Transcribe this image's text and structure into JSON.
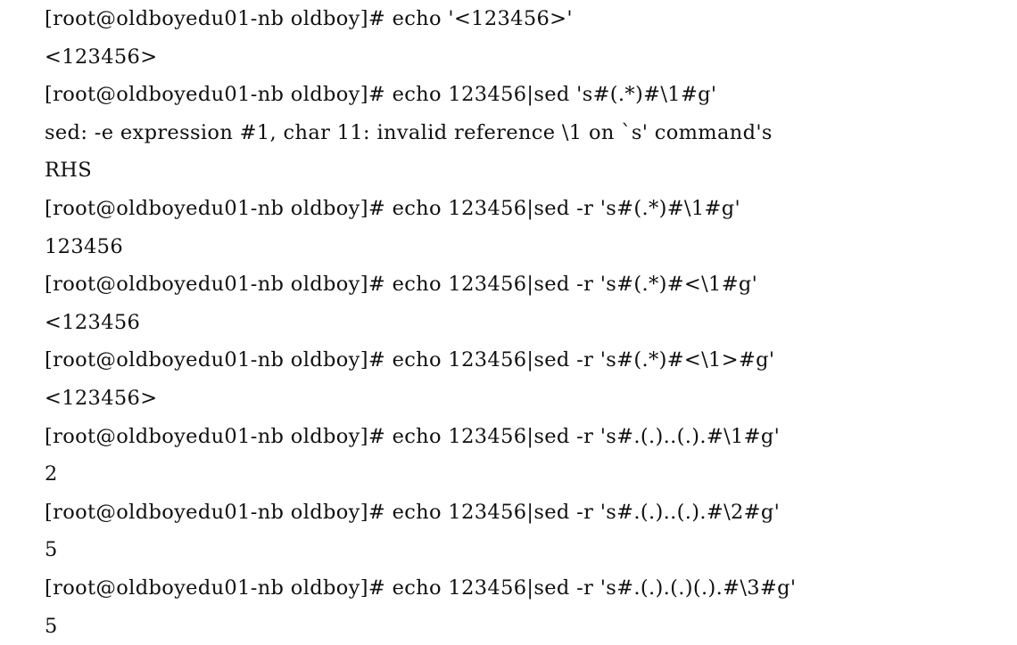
{
  "terminal": {
    "prompt": "[root@oldboyedu01-nb oldboy]#",
    "background_color": "#ffffff",
    "text_color": "#101010",
    "lines": [
      {
        "type": "command",
        "prompt": "[root@oldboyedu01-nb oldboy]#",
        "text": " echo '<123456>'"
      },
      {
        "type": "output",
        "text": "<123456>"
      },
      {
        "type": "command",
        "prompt": "[root@oldboyedu01-nb oldboy]#",
        "text": " echo 123456|sed 's#(.*)#\\1#g'"
      },
      {
        "type": "error",
        "text": "sed: -e expression #1, char 11: invalid reference \\1 on `s' command's"
      },
      {
        "type": "error",
        "text": "RHS"
      },
      {
        "type": "command",
        "prompt": "[root@oldboyedu01-nb oldboy]#",
        "text": " echo 123456|sed -r 's#(.*)#\\1#g'"
      },
      {
        "type": "output",
        "text": "123456"
      },
      {
        "type": "command",
        "prompt": "[root@oldboyedu01-nb oldboy]#",
        "text": " echo 123456|sed -r 's#(.*)#<\\1#g'"
      },
      {
        "type": "output",
        "text": "<123456"
      },
      {
        "type": "command",
        "prompt": "[root@oldboyedu01-nb oldboy]#",
        "text": " echo 123456|sed -r 's#(.*)#<\\1>#g'"
      },
      {
        "type": "output",
        "text": "<123456>"
      },
      {
        "type": "command",
        "prompt": "[root@oldboyedu01-nb oldboy]#",
        "text": " echo 123456|sed -r 's#.(.)..(.).#\\1#g'"
      },
      {
        "type": "output",
        "text": "2"
      },
      {
        "type": "command",
        "prompt": "[root@oldboyedu01-nb oldboy]#",
        "text": " echo 123456|sed -r 's#.(.)..(.).#\\2#g'"
      },
      {
        "type": "output",
        "text": "5"
      },
      {
        "type": "command",
        "prompt": "[root@oldboyedu01-nb oldboy]#",
        "text": " echo 123456|sed -r 's#.(.).(.)(.).#\\3#g'"
      },
      {
        "type": "output",
        "text": "5"
      }
    ]
  }
}
